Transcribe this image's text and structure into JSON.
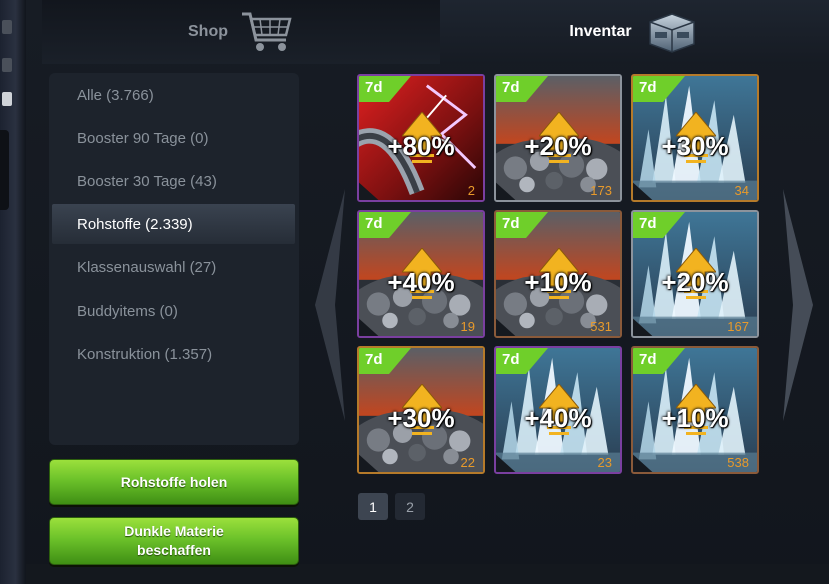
{
  "tabs": {
    "shop": {
      "label": "Shop",
      "icon": "shopping-cart-icon"
    },
    "inventory": {
      "label": "Inventar",
      "icon": "storage-crate-icon"
    }
  },
  "categories": [
    {
      "label": "Alle (3.766)",
      "active": false
    },
    {
      "label": "Booster 90 Tage (0)",
      "active": false
    },
    {
      "label": "Booster 30 Tage (43)",
      "active": false
    },
    {
      "label": "Rohstoffe (2.339)",
      "active": true
    },
    {
      "label": "Klassenauswahl (27)",
      "active": false
    },
    {
      "label": "Buddyitems (0)",
      "active": false
    },
    {
      "label": "Konstruktion (1.357)",
      "active": false
    }
  ],
  "buttons": {
    "get_resources": "Rohstoffe holen",
    "dark_matter_line1": "Dunkle Materie",
    "dark_matter_line2": "beschaffen"
  },
  "items": [
    {
      "duration": "7d",
      "bonus": "+80%",
      "quantity": "2",
      "theme": "energy",
      "frame": "#7a3fa0"
    },
    {
      "duration": "7d",
      "bonus": "+20%",
      "quantity": "173",
      "theme": "ore",
      "frame": "#8c939c"
    },
    {
      "duration": "7d",
      "bonus": "+30%",
      "quantity": "34",
      "theme": "crystal",
      "frame": "#b57a2a"
    },
    {
      "duration": "7d",
      "bonus": "+40%",
      "quantity": "19",
      "theme": "ore",
      "frame": "#7a3fa0"
    },
    {
      "duration": "7d",
      "bonus": "+10%",
      "quantity": "531",
      "theme": "ore",
      "frame": "#8a5a3a"
    },
    {
      "duration": "7d",
      "bonus": "+20%",
      "quantity": "167",
      "theme": "crystal",
      "frame": "#8c939c"
    },
    {
      "duration": "7d",
      "bonus": "+30%",
      "quantity": "22",
      "theme": "ore",
      "frame": "#b57a2a"
    },
    {
      "duration": "7d",
      "bonus": "+40%",
      "quantity": "23",
      "theme": "crystal",
      "frame": "#7a3fa0"
    },
    {
      "duration": "7d",
      "bonus": "+10%",
      "quantity": "538",
      "theme": "crystal",
      "frame": "#8a5a3a"
    }
  ],
  "pagination": {
    "pages": [
      "1",
      "2"
    ],
    "current": "1"
  },
  "colors": {
    "accent_green": "#6cc22a",
    "badge_green": "#6fcf2a",
    "quantity_orange": "#e89a2b",
    "arrow_gold": "#f2b320"
  }
}
